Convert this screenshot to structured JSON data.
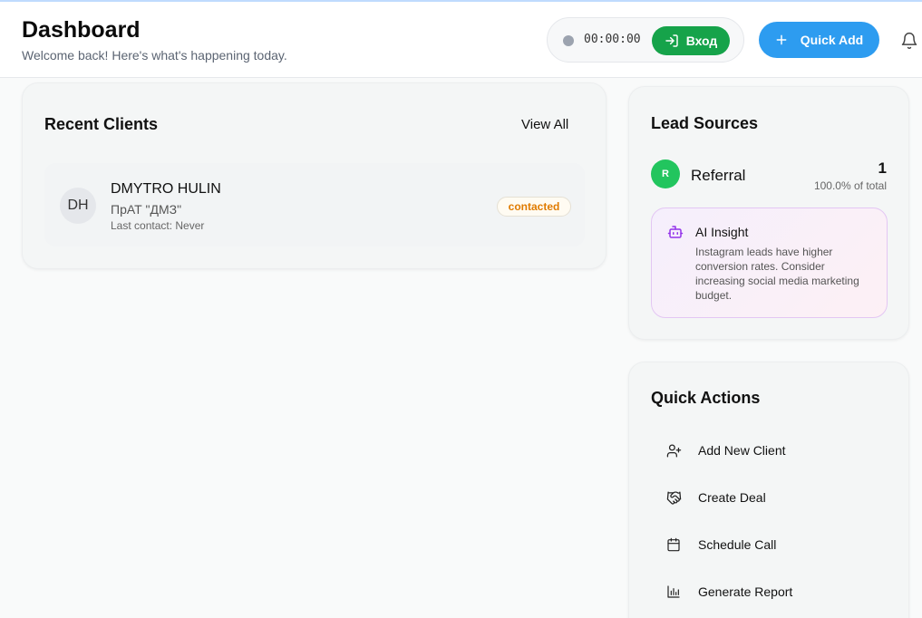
{
  "header": {
    "title": "Dashboard",
    "subtitle": "Welcome back! Here's what's happening today.",
    "timer": "00:00:00",
    "login_label": "Вход",
    "quick_add_label": "Quick Add"
  },
  "recent_clients": {
    "title": "Recent Clients",
    "view_all": "View All",
    "clients": [
      {
        "initials": "DH",
        "name": "DMYTRO HULIN",
        "company": "ПрАТ \"ДМЗ\"",
        "last_contact": "Last contact: Never",
        "status": "contacted"
      }
    ]
  },
  "lead_sources": {
    "title": "Lead Sources",
    "sources": [
      {
        "initial": "R",
        "name": "Referral",
        "count": "1",
        "percent": "100.0% of total",
        "color": "#22c55e"
      }
    ],
    "insight": {
      "title": "AI Insight",
      "text": "Instagram leads have higher conversion rates. Consider increasing social media marketing budget."
    }
  },
  "quick_actions": {
    "title": "Quick Actions",
    "items": [
      {
        "label": "Add New Client",
        "icon": "user-plus-icon"
      },
      {
        "label": "Create Deal",
        "icon": "handshake-icon"
      },
      {
        "label": "Schedule Call",
        "icon": "calendar-icon"
      },
      {
        "label": "Generate Report",
        "icon": "bar-chart-icon"
      }
    ]
  },
  "colors": {
    "accent_blue": "#2d9cf0",
    "login_green": "#16a34a",
    "status_orange": "#e07b00",
    "insight_purple": "#9333ea"
  }
}
